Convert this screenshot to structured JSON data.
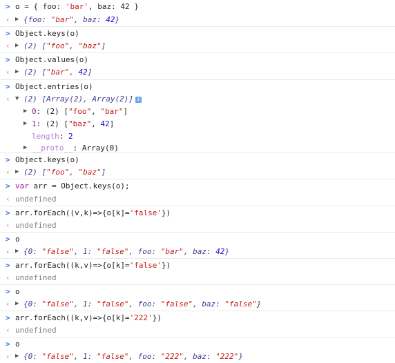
{
  "console": {
    "lines": [
      {
        "kind": "input",
        "text": "o = { foo: 'bar', baz: 42 }"
      },
      {
        "kind": "output",
        "text": "{foo: \"bar\", baz: 42}"
      },
      {
        "kind": "input",
        "text": "Object.keys(o)"
      },
      {
        "kind": "output",
        "text": "(2) [\"foo\", \"baz\"]"
      },
      {
        "kind": "input",
        "text": "Object.values(o)"
      },
      {
        "kind": "output",
        "text": "(2) [\"bar\", 42]"
      },
      {
        "kind": "input",
        "text": "Object.entries(o)"
      },
      {
        "kind": "output-expanded",
        "text": "(2) [Array(2), Array(2)]"
      },
      {
        "kind": "child",
        "text": "0: (2) [\"foo\", \"bar\"]"
      },
      {
        "kind": "child",
        "text": "1: (2) [\"baz\", 42]"
      },
      {
        "kind": "prop",
        "text": "length: 2"
      },
      {
        "kind": "child",
        "text": "__proto__: Array(0)"
      },
      {
        "kind": "input",
        "text": "Object.keys(o)"
      },
      {
        "kind": "output",
        "text": "(2) [\"foo\", \"baz\"]"
      },
      {
        "kind": "input",
        "text": "var arr = Object.keys(o);"
      },
      {
        "kind": "undef",
        "text": "undefined"
      },
      {
        "kind": "input",
        "text": "arr.forEach((v,k)=>{o[k]='false'})"
      },
      {
        "kind": "undef",
        "text": "undefined"
      },
      {
        "kind": "input",
        "text": "o"
      },
      {
        "kind": "output",
        "text": "{0: \"false\", 1: \"false\", foo: \"bar\", baz: 42}"
      },
      {
        "kind": "input",
        "text": "arr.forEach((k,v)=>{o[k]='false'})"
      },
      {
        "kind": "undef",
        "text": "undefined"
      },
      {
        "kind": "input",
        "text": "o"
      },
      {
        "kind": "output",
        "text": "{0: \"false\", 1: \"false\", foo: \"false\", baz: \"false\"}"
      },
      {
        "kind": "input",
        "text": "arr.forEach((k,v)=>{o[k]='222'})"
      },
      {
        "kind": "undef",
        "text": "undefined"
      },
      {
        "kind": "input",
        "text": "o"
      },
      {
        "kind": "output",
        "text": "{0: \"false\", 1: \"false\", foo: \"222\", baz: \"222\"}"
      }
    ]
  },
  "icons": {
    "input_prompt": "chevron-right-icon",
    "output_prompt": "return-arrow-icon",
    "collapsed": "triangle-right-icon",
    "expanded": "triangle-down-icon",
    "info": "info-icon"
  },
  "colors": {
    "prompt": "#3a73d8",
    "string": "#c41a16",
    "number": "#1c00cf",
    "keyword": "#aa0d91",
    "undefined": "#808080",
    "separator": "#eaeaea"
  }
}
